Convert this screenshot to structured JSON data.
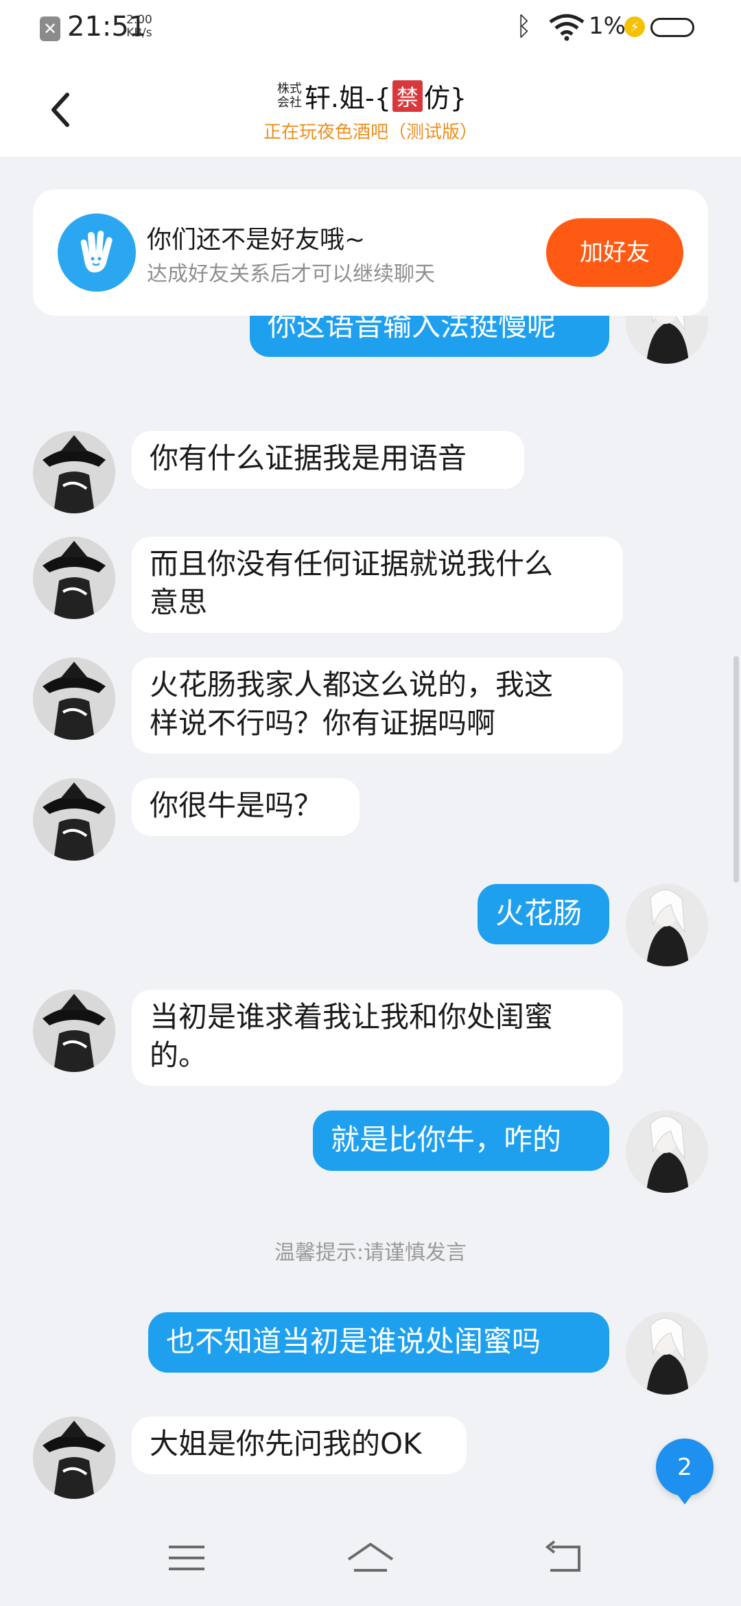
{
  "status_bar": {
    "time": "21:51",
    "speed_value": "2.00",
    "speed_unit": "KB/s",
    "battery": "1%",
    "notification_icon": "close-x-icon"
  },
  "header": {
    "title_prefix": "株式会社",
    "title_main": "轩.姐-{",
    "title_badge": "禁",
    "title_end": "仿}",
    "subtitle": "正在玩夜色酒吧（测试版）"
  },
  "friend_card": {
    "title": "你们还不是好友哦~",
    "subtitle": "达成好友关系后才可以继续聊天",
    "add_button": "加好友",
    "accent": "#ff5a14"
  },
  "messages": [
    {
      "side": "out",
      "text": "你这语音输入法挺慢呢"
    },
    {
      "side": "in",
      "text": "你有什么证据我是用语音"
    },
    {
      "side": "in",
      "text": "而且你没有任何证据就说我什么\n意思"
    },
    {
      "side": "in",
      "text": "火花肠我家人都这么说的，我这\n样说不行吗？你有证据吗啊"
    },
    {
      "side": "in",
      "text": "你很牛是吗？"
    },
    {
      "side": "out",
      "text": "火花肠"
    },
    {
      "side": "in",
      "text": "当初是谁求着我让我和你处闺蜜\n的。"
    },
    {
      "side": "out",
      "text": "就是比你牛，咋的"
    },
    {
      "side": "out",
      "text": "也不知道当初是谁说处闺蜜吗"
    },
    {
      "side": "in",
      "text": "大姐是你先问我的OK"
    }
  ],
  "system_tip": "温馨提示:请谨慎发言",
  "unread_count": "2",
  "colors": {
    "outgoing_bubble": "#1ea0ef",
    "incoming_bubble": "#ffffff",
    "background": "#f1f2f6"
  },
  "nav": {
    "icons": [
      "menu-icon",
      "home-icon",
      "back-icon"
    ]
  }
}
